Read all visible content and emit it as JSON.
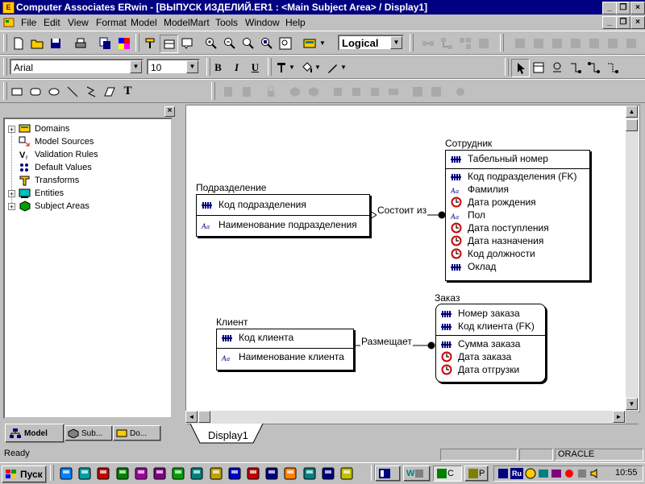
{
  "window": {
    "title": "Computer Associates ERwin - [ВЫПУСК ИЗДЕЛИЙ.ER1 : <Main Subject Area> / Display1]",
    "app_icon": "erwin-icon"
  },
  "menu": [
    "File",
    "Edit",
    "View",
    "Format",
    "Model",
    "ModelMart",
    "Tools",
    "Window",
    "Help"
  ],
  "toolbar": {
    "view_level": "Logical",
    "font_name": "Arial",
    "font_size": "10",
    "bold": "B",
    "italic": "I",
    "underline": "U"
  },
  "tree": [
    {
      "label": "Domains",
      "expandable": true,
      "icon": "domains-icon"
    },
    {
      "label": "Model Sources",
      "expandable": false,
      "icon": "model-sources-icon"
    },
    {
      "label": "Validation Rules",
      "expandable": false,
      "icon": "validation-rules-icon"
    },
    {
      "label": "Default Values",
      "expandable": false,
      "icon": "default-values-icon"
    },
    {
      "label": "Transforms",
      "expandable": false,
      "icon": "transforms-icon"
    },
    {
      "label": "Entities",
      "expandable": true,
      "icon": "entities-icon"
    },
    {
      "label": "Subject Areas",
      "expandable": true,
      "icon": "subject-areas-icon"
    }
  ],
  "left_tabs": [
    "Model",
    "Sub...",
    "Do..."
  ],
  "entities": {
    "podrazdelenie": {
      "name": "Подразделение",
      "keys": [
        {
          "label": "Код подразделения",
          "icon": "key-icon"
        }
      ],
      "attrs": [
        {
          "label": "Наименование подразделения",
          "icon": "text-attr-icon"
        }
      ]
    },
    "sotrudnik": {
      "name": "Сотрудник",
      "keys": [
        {
          "label": "Табельный номер",
          "icon": "key-icon"
        }
      ],
      "attrs": [
        {
          "label": "Код подразделения (FK)",
          "icon": "key-icon"
        },
        {
          "label": "Фамилия",
          "icon": "text-attr-icon"
        },
        {
          "label": "Дата рождения",
          "icon": "clock-icon"
        },
        {
          "label": "Пол",
          "icon": "text-attr-icon"
        },
        {
          "label": "Дата поступления",
          "icon": "clock-icon"
        },
        {
          "label": "Дата назначения",
          "icon": "clock-icon"
        },
        {
          "label": "Код должности",
          "icon": "clock-icon"
        },
        {
          "label": "Оклад",
          "icon": "key-icon"
        }
      ]
    },
    "klient": {
      "name": "Клиент",
      "keys": [
        {
          "label": "Код клиента",
          "icon": "key-icon"
        }
      ],
      "attrs": [
        {
          "label": "Наименование клиента",
          "icon": "text-attr-icon"
        }
      ]
    },
    "zakaz": {
      "name": "Заказ",
      "keys": [
        {
          "label": "Номер заказа",
          "icon": "key-icon"
        },
        {
          "label": "Код клиента (FK)",
          "icon": "key-icon"
        }
      ],
      "attrs": [
        {
          "label": "Сумма заказа",
          "icon": "key-icon"
        },
        {
          "label": "Дата заказа",
          "icon": "clock-icon"
        },
        {
          "label": "Дата отгрузки",
          "icon": "clock-icon"
        }
      ]
    }
  },
  "relationships": [
    {
      "label": "Состоит из",
      "from": "Подразделение",
      "to": "Сотрудник"
    },
    {
      "label": "Размещает",
      "from": "Клиент",
      "to": "Заказ"
    }
  ],
  "display_tab": "Display1",
  "status": {
    "text": "Ready",
    "db": "ORACLE"
  },
  "taskbar": {
    "start": "Пуск",
    "tasks": [
      "",
      "W",
      "C",
      "P"
    ],
    "clock": "10:55",
    "lang": "Ru"
  },
  "colors": {
    "titlebar": "#000080",
    "key_icon": "#000080",
    "clock_icon": "#cc0000"
  }
}
